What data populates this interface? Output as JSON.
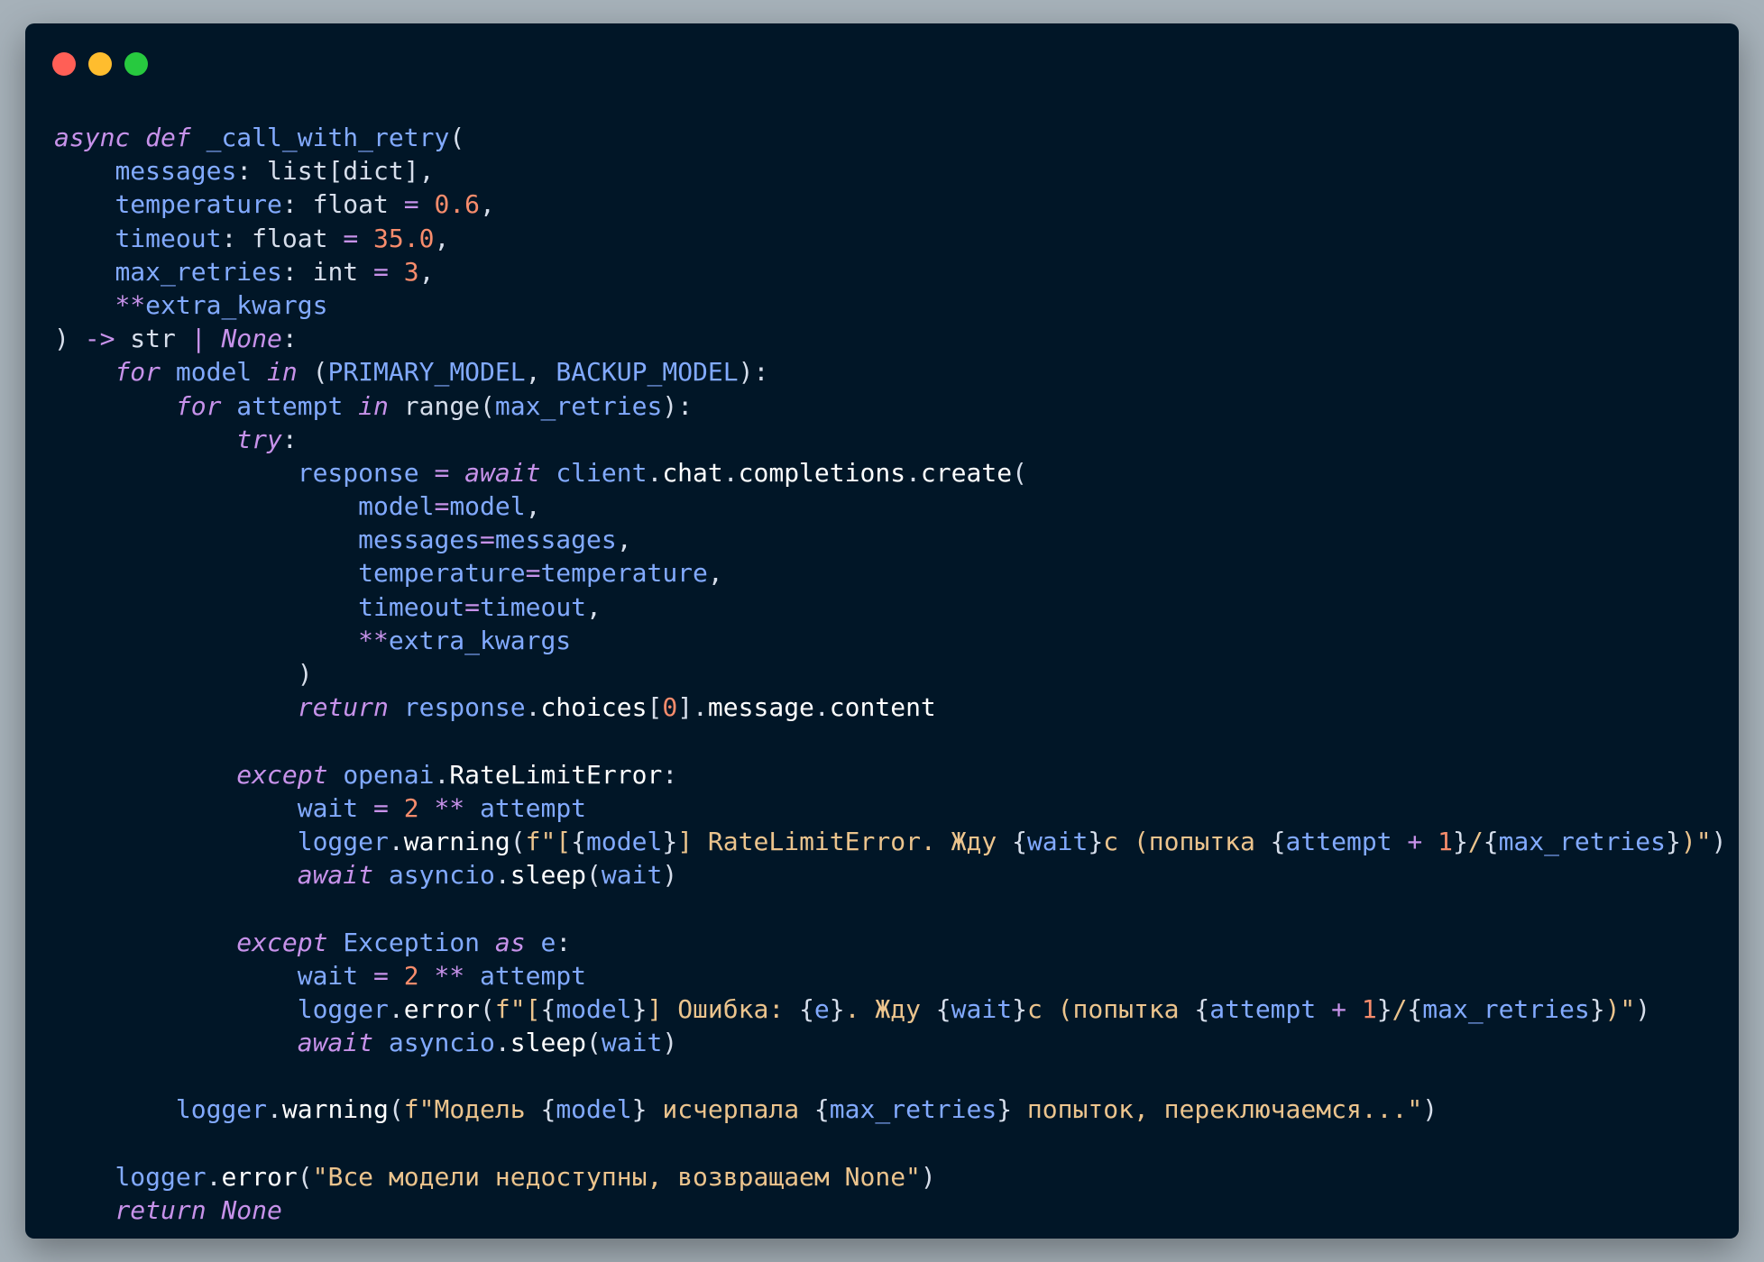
{
  "window": {
    "traffic_lights": [
      {
        "name": "close",
        "color": "#ff5f56"
      },
      {
        "name": "minimize",
        "color": "#ffbd2e"
      },
      {
        "name": "zoom",
        "color": "#27c93f"
      }
    ]
  },
  "theme": {
    "background": "#011627",
    "keyword": "#c792ea",
    "variable": "#82aaff",
    "number": "#f78c6c",
    "string": "#ecc48d",
    "plain": "#d6deeb",
    "member": "#ffffff"
  },
  "code": {
    "language": "python",
    "lines": [
      [
        [
          "kw",
          "async"
        ],
        [
          "pl",
          " "
        ],
        [
          "kw",
          "def"
        ],
        [
          "pl",
          " "
        ],
        [
          "fn",
          "_call_with_retry"
        ],
        [
          "pl",
          "("
        ]
      ],
      [
        [
          "pl",
          "    "
        ],
        [
          "var",
          "messages"
        ],
        [
          "pl",
          ": list[dict],"
        ]
      ],
      [
        [
          "pl",
          "    "
        ],
        [
          "var",
          "temperature"
        ],
        [
          "pl",
          ": float "
        ],
        [
          "op",
          "="
        ],
        [
          "pl",
          " "
        ],
        [
          "num",
          "0.6"
        ],
        [
          "pl",
          ","
        ]
      ],
      [
        [
          "pl",
          "    "
        ],
        [
          "var",
          "timeout"
        ],
        [
          "pl",
          ": float "
        ],
        [
          "op",
          "="
        ],
        [
          "pl",
          " "
        ],
        [
          "num",
          "35.0"
        ],
        [
          "pl",
          ","
        ]
      ],
      [
        [
          "pl",
          "    "
        ],
        [
          "var",
          "max_retries"
        ],
        [
          "pl",
          ": int "
        ],
        [
          "op",
          "="
        ],
        [
          "pl",
          " "
        ],
        [
          "num",
          "3"
        ],
        [
          "pl",
          ","
        ]
      ],
      [
        [
          "pl",
          "    "
        ],
        [
          "op",
          "**"
        ],
        [
          "var",
          "extra_kwargs"
        ]
      ],
      [
        [
          "pl",
          ") "
        ],
        [
          "op",
          "->"
        ],
        [
          "pl",
          " str "
        ],
        [
          "op",
          "|"
        ],
        [
          "pl",
          " "
        ],
        [
          "kw",
          "None"
        ],
        [
          "pl",
          ":"
        ]
      ],
      [
        [
          "pl",
          "    "
        ],
        [
          "kw",
          "for"
        ],
        [
          "pl",
          " "
        ],
        [
          "var",
          "model"
        ],
        [
          "pl",
          " "
        ],
        [
          "kw",
          "in"
        ],
        [
          "pl",
          " ("
        ],
        [
          "var",
          "PRIMARY_MODEL"
        ],
        [
          "pl",
          ", "
        ],
        [
          "var",
          "BACKUP_MODEL"
        ],
        [
          "pl",
          "):"
        ]
      ],
      [
        [
          "pl",
          "        "
        ],
        [
          "kw",
          "for"
        ],
        [
          "pl",
          " "
        ],
        [
          "var",
          "attempt"
        ],
        [
          "pl",
          " "
        ],
        [
          "kw",
          "in"
        ],
        [
          "pl",
          " range("
        ],
        [
          "var",
          "max_retries"
        ],
        [
          "pl",
          "):"
        ]
      ],
      [
        [
          "pl",
          "            "
        ],
        [
          "kw",
          "try"
        ],
        [
          "pl",
          ":"
        ]
      ],
      [
        [
          "pl",
          "                "
        ],
        [
          "var",
          "response"
        ],
        [
          "pl",
          " "
        ],
        [
          "op",
          "="
        ],
        [
          "pl",
          " "
        ],
        [
          "kw",
          "await"
        ],
        [
          "pl",
          " "
        ],
        [
          "var",
          "client"
        ],
        [
          "pl",
          "."
        ],
        [
          "mem",
          "chat"
        ],
        [
          "pl",
          "."
        ],
        [
          "mem",
          "completions"
        ],
        [
          "pl",
          "."
        ],
        [
          "mem",
          "create"
        ],
        [
          "pl",
          "("
        ]
      ],
      [
        [
          "pl",
          "                    "
        ],
        [
          "var",
          "model"
        ],
        [
          "op",
          "="
        ],
        [
          "var",
          "model"
        ],
        [
          "pl",
          ","
        ]
      ],
      [
        [
          "pl",
          "                    "
        ],
        [
          "var",
          "messages"
        ],
        [
          "op",
          "="
        ],
        [
          "var",
          "messages"
        ],
        [
          "pl",
          ","
        ]
      ],
      [
        [
          "pl",
          "                    "
        ],
        [
          "var",
          "temperature"
        ],
        [
          "op",
          "="
        ],
        [
          "var",
          "temperature"
        ],
        [
          "pl",
          ","
        ]
      ],
      [
        [
          "pl",
          "                    "
        ],
        [
          "var",
          "timeout"
        ],
        [
          "op",
          "="
        ],
        [
          "var",
          "timeout"
        ],
        [
          "pl",
          ","
        ]
      ],
      [
        [
          "pl",
          "                    "
        ],
        [
          "op",
          "**"
        ],
        [
          "var",
          "extra_kwargs"
        ]
      ],
      [
        [
          "pl",
          "                )"
        ]
      ],
      [
        [
          "pl",
          "                "
        ],
        [
          "kw",
          "return"
        ],
        [
          "pl",
          " "
        ],
        [
          "var",
          "response"
        ],
        [
          "pl",
          "."
        ],
        [
          "mem",
          "choices"
        ],
        [
          "pl",
          "["
        ],
        [
          "num",
          "0"
        ],
        [
          "pl",
          "]."
        ],
        [
          "mem",
          "message"
        ],
        [
          "pl",
          "."
        ],
        [
          "mem",
          "content"
        ]
      ],
      [],
      [
        [
          "pl",
          "            "
        ],
        [
          "kw",
          "except"
        ],
        [
          "pl",
          " "
        ],
        [
          "var",
          "openai"
        ],
        [
          "pl",
          "."
        ],
        [
          "mem",
          "RateLimitError"
        ],
        [
          "pl",
          ":"
        ]
      ],
      [
        [
          "pl",
          "                "
        ],
        [
          "var",
          "wait"
        ],
        [
          "pl",
          " "
        ],
        [
          "op",
          "="
        ],
        [
          "pl",
          " "
        ],
        [
          "num",
          "2"
        ],
        [
          "pl",
          " "
        ],
        [
          "op",
          "**"
        ],
        [
          "pl",
          " "
        ],
        [
          "var",
          "attempt"
        ]
      ],
      [
        [
          "pl",
          "                "
        ],
        [
          "var",
          "logger"
        ],
        [
          "pl",
          "."
        ],
        [
          "mem",
          "warning"
        ],
        [
          "pl",
          "("
        ],
        [
          "str",
          "f\"["
        ],
        [
          "pl",
          "{"
        ],
        [
          "var",
          "model"
        ],
        [
          "pl",
          "}"
        ],
        [
          "str",
          "] RateLimitError. Жду "
        ],
        [
          "pl",
          "{"
        ],
        [
          "var",
          "wait"
        ],
        [
          "pl",
          "}"
        ],
        [
          "str",
          "с (попытка "
        ],
        [
          "pl",
          "{"
        ],
        [
          "var",
          "attempt"
        ],
        [
          "pl",
          " "
        ],
        [
          "op",
          "+"
        ],
        [
          "pl",
          " "
        ],
        [
          "num",
          "1"
        ],
        [
          "pl",
          "}"
        ],
        [
          "str",
          "/"
        ],
        [
          "pl",
          "{"
        ],
        [
          "var",
          "max_retries"
        ],
        [
          "pl",
          "}"
        ],
        [
          "str",
          ")\""
        ],
        [
          "pl",
          ")"
        ]
      ],
      [
        [
          "pl",
          "                "
        ],
        [
          "kw",
          "await"
        ],
        [
          "pl",
          " "
        ],
        [
          "var",
          "asyncio"
        ],
        [
          "pl",
          "."
        ],
        [
          "mem",
          "sleep"
        ],
        [
          "pl",
          "("
        ],
        [
          "var",
          "wait"
        ],
        [
          "pl",
          ")"
        ]
      ],
      [],
      [
        [
          "pl",
          "            "
        ],
        [
          "kw",
          "except"
        ],
        [
          "pl",
          " "
        ],
        [
          "var",
          "Exception"
        ],
        [
          "pl",
          " "
        ],
        [
          "kw",
          "as"
        ],
        [
          "pl",
          " "
        ],
        [
          "var",
          "e"
        ],
        [
          "pl",
          ":"
        ]
      ],
      [
        [
          "pl",
          "                "
        ],
        [
          "var",
          "wait"
        ],
        [
          "pl",
          " "
        ],
        [
          "op",
          "="
        ],
        [
          "pl",
          " "
        ],
        [
          "num",
          "2"
        ],
        [
          "pl",
          " "
        ],
        [
          "op",
          "**"
        ],
        [
          "pl",
          " "
        ],
        [
          "var",
          "attempt"
        ]
      ],
      [
        [
          "pl",
          "                "
        ],
        [
          "var",
          "logger"
        ],
        [
          "pl",
          "."
        ],
        [
          "mem",
          "error"
        ],
        [
          "pl",
          "("
        ],
        [
          "str",
          "f\"["
        ],
        [
          "pl",
          "{"
        ],
        [
          "var",
          "model"
        ],
        [
          "pl",
          "}"
        ],
        [
          "str",
          "] Ошибка: "
        ],
        [
          "pl",
          "{"
        ],
        [
          "var",
          "e"
        ],
        [
          "pl",
          "}"
        ],
        [
          "str",
          ". Жду "
        ],
        [
          "pl",
          "{"
        ],
        [
          "var",
          "wait"
        ],
        [
          "pl",
          "}"
        ],
        [
          "str",
          "с (попытка "
        ],
        [
          "pl",
          "{"
        ],
        [
          "var",
          "attempt"
        ],
        [
          "pl",
          " "
        ],
        [
          "op",
          "+"
        ],
        [
          "pl",
          " "
        ],
        [
          "num",
          "1"
        ],
        [
          "pl",
          "}"
        ],
        [
          "str",
          "/"
        ],
        [
          "pl",
          "{"
        ],
        [
          "var",
          "max_retries"
        ],
        [
          "pl",
          "}"
        ],
        [
          "str",
          ")\""
        ],
        [
          "pl",
          ")"
        ]
      ],
      [
        [
          "pl",
          "                "
        ],
        [
          "kw",
          "await"
        ],
        [
          "pl",
          " "
        ],
        [
          "var",
          "asyncio"
        ],
        [
          "pl",
          "."
        ],
        [
          "mem",
          "sleep"
        ],
        [
          "pl",
          "("
        ],
        [
          "var",
          "wait"
        ],
        [
          "pl",
          ")"
        ]
      ],
      [],
      [
        [
          "pl",
          "        "
        ],
        [
          "var",
          "logger"
        ],
        [
          "pl",
          "."
        ],
        [
          "mem",
          "warning"
        ],
        [
          "pl",
          "("
        ],
        [
          "str",
          "f\"Модель "
        ],
        [
          "pl",
          "{"
        ],
        [
          "var",
          "model"
        ],
        [
          "pl",
          "}"
        ],
        [
          "str",
          " исчерпала "
        ],
        [
          "pl",
          "{"
        ],
        [
          "var",
          "max_retries"
        ],
        [
          "pl",
          "}"
        ],
        [
          "str",
          " попыток, переключаемся...\""
        ],
        [
          "pl",
          ")"
        ]
      ],
      [],
      [
        [
          "pl",
          "    "
        ],
        [
          "var",
          "logger"
        ],
        [
          "pl",
          "."
        ],
        [
          "mem",
          "error"
        ],
        [
          "pl",
          "("
        ],
        [
          "str",
          "\"Все модели недоступны, возвращаем None\""
        ],
        [
          "pl",
          ")"
        ]
      ],
      [
        [
          "pl",
          "    "
        ],
        [
          "kw",
          "return"
        ],
        [
          "pl",
          " "
        ],
        [
          "kw",
          "None"
        ]
      ]
    ]
  }
}
